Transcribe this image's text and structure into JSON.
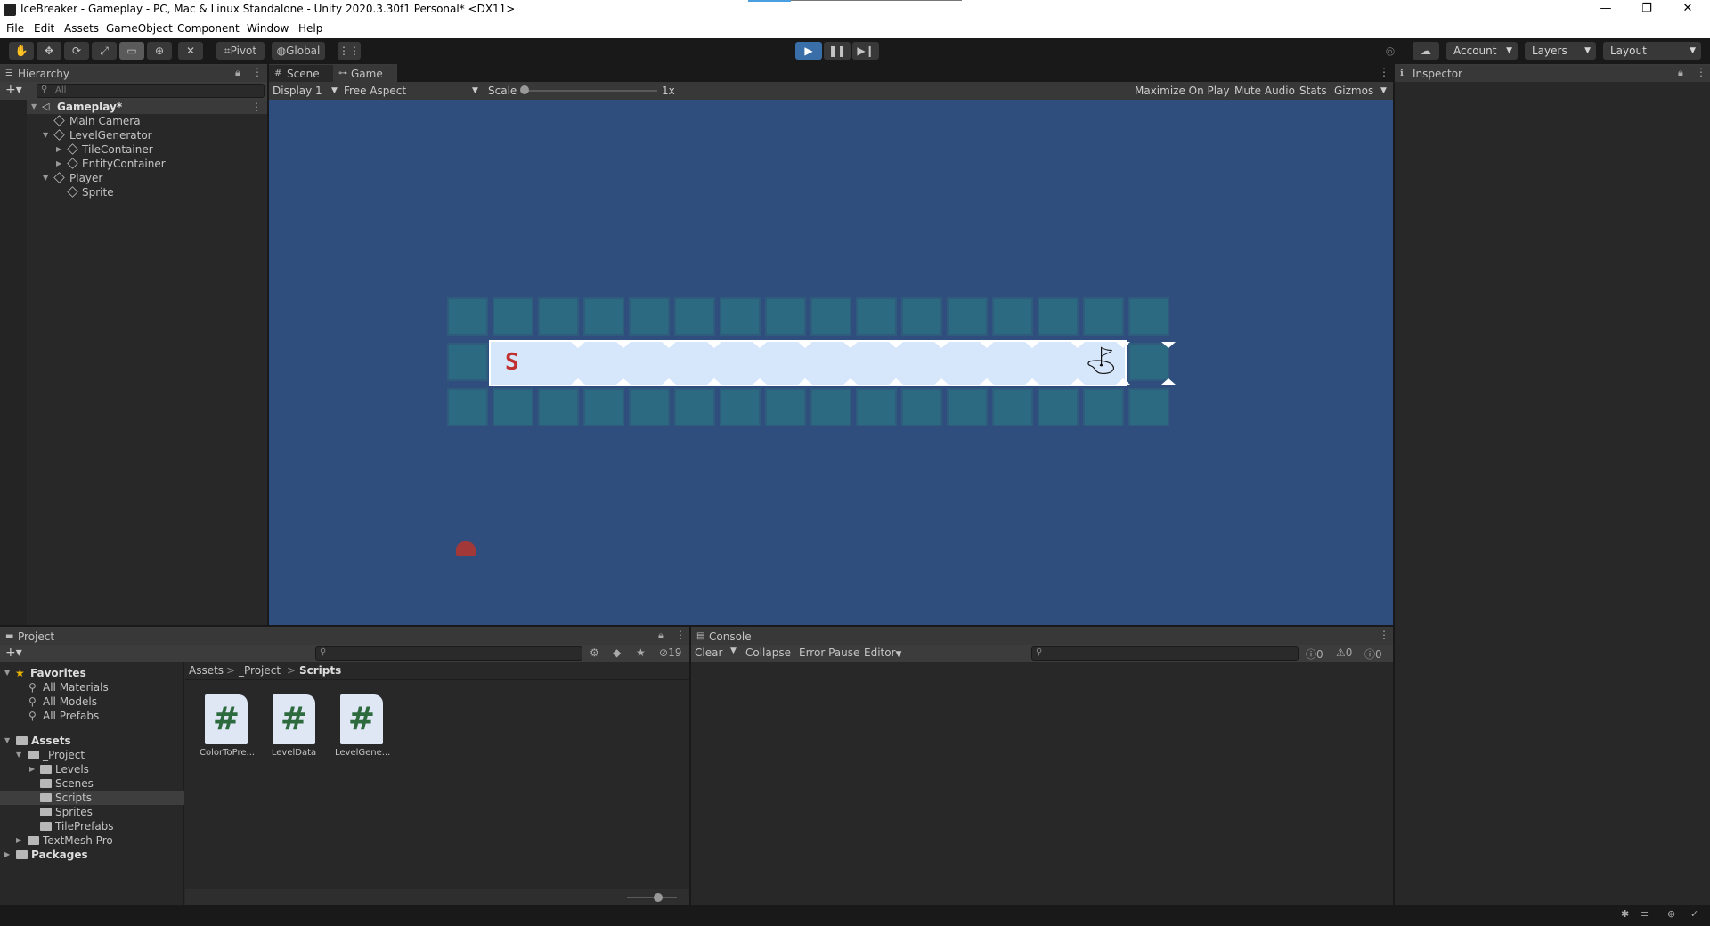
{
  "window": {
    "title": "IceBreaker - Gameplay - PC, Mac & Linux Standalone - Unity 2020.3.30f1 Personal* <DX11>",
    "minimize": "—",
    "restore": "❐",
    "close": "✕"
  },
  "menu": [
    "File",
    "Edit",
    "Assets",
    "GameObject",
    "Component",
    "Window",
    "Help"
  ],
  "toolbar": {
    "pivot": "Pivot",
    "global": "Global",
    "account": "Account",
    "layers": "Layers",
    "layout": "Layout"
  },
  "hierarchy": {
    "tab": "Hierarchy",
    "search_placeholder": "All",
    "items": [
      {
        "label": "Gameplay*"
      },
      {
        "label": "Main Camera"
      },
      {
        "label": "LevelGenerator"
      },
      {
        "label": "TileContainer"
      },
      {
        "label": "EntityContainer"
      },
      {
        "label": "Player"
      },
      {
        "label": "Sprite"
      }
    ]
  },
  "game_panel": {
    "tabs": [
      "Scene",
      "Game"
    ],
    "display": "Display 1",
    "aspect": "Free Aspect",
    "scale_label": "Scale",
    "scale_value": "1x",
    "scale_level": 0.0,
    "maximize_on_play": "Maximize On Play",
    "mute_audio": "Mute Audio",
    "stats": "Stats",
    "gizmos": "Gizmos",
    "start_marker": "S"
  },
  "inspector": {
    "tab": "Inspector"
  },
  "project": {
    "tab": "Project",
    "hidden_count": "19",
    "favorites": {
      "label": "Favorites",
      "items": [
        "All Materials",
        "All Models",
        "All Prefabs"
      ]
    },
    "assets": {
      "label": "Assets",
      "project_folder": "_Project",
      "subfolders": [
        "Levels",
        "Scenes",
        "Scripts",
        "Sprites",
        "TilePrefabs"
      ],
      "textmesh": "TextMesh Pro"
    },
    "packages": "Packages",
    "breadcrumb": [
      "Assets",
      "_Project",
      "Scripts"
    ],
    "breadcrumb_sep": ">",
    "files": [
      {
        "icon": "#",
        "name": "ColorToPre..."
      },
      {
        "icon": "#",
        "name": "LevelData"
      },
      {
        "icon": "#",
        "name": "LevelGene..."
      }
    ]
  },
  "console": {
    "tab": "Console",
    "clear": "Clear",
    "collapse": "Collapse",
    "error_pause": "Error Pause",
    "editor": "Editor",
    "info_count": "0",
    "warn_count": "0",
    "error_count": "0"
  },
  "colors": {
    "game_background": "#2f4e7e",
    "tile": "#2b6a80",
    "ice": "#d6e6fb",
    "play_button": "#3a6ea8"
  }
}
